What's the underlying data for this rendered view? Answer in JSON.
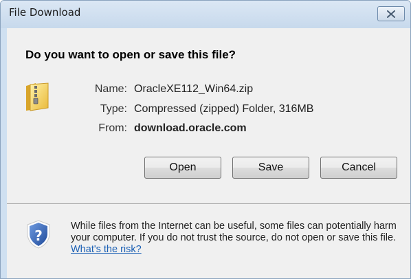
{
  "window": {
    "title": "File Download"
  },
  "dialog": {
    "question": "Do you want to open or save this file?",
    "file": {
      "name_label": "Name:",
      "name_value": "OracleXE112_Win64.zip",
      "type_label": "Type:",
      "type_value": "Compressed (zipped) Folder, 316MB",
      "from_label": "From:",
      "from_value": "download.oracle.com"
    },
    "buttons": {
      "open": "Open",
      "save": "Save",
      "cancel": "Cancel"
    },
    "warning": {
      "text": "While files from the Internet can be useful, some files can potentially harm your computer. If you do not trust the source, do not open or save this file. ",
      "link": "What's the risk?"
    }
  },
  "icons": {
    "close": "close-icon",
    "file": "zip-folder-icon",
    "warning": "shield-question-icon"
  },
  "colors": {
    "link": "#1a5fb4",
    "shield_blue": "#2c5aa8"
  }
}
